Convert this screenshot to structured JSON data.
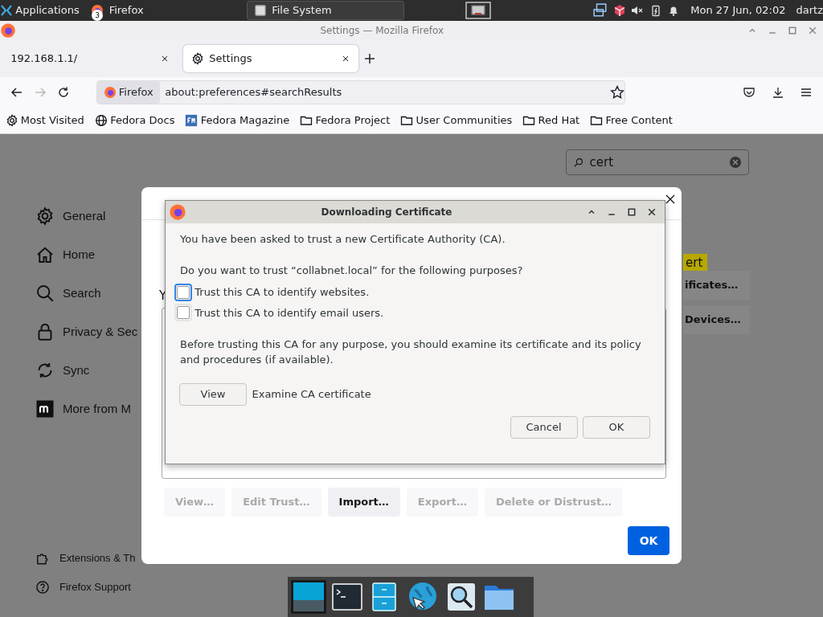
{
  "top_panel": {
    "applications": "Applications",
    "tasks": [
      {
        "label": "Firefox",
        "badge": "3",
        "selected": false
      },
      {
        "label": "File System",
        "selected": true
      }
    ],
    "clock": "Mon 27 Jun, 02:02",
    "user": "dartz"
  },
  "window": {
    "title": "Settings — Mozilla Firefox"
  },
  "tabs": [
    {
      "label": "192.168.1.1/",
      "selected": false
    },
    {
      "label": "Settings",
      "selected": true
    }
  ],
  "url_bar": {
    "identity": "Firefox",
    "url": "about:preferences#searchResults"
  },
  "bookmarks": [
    {
      "label": "Most Visited",
      "kind": "gear"
    },
    {
      "label": "Fedora Docs",
      "kind": "globe"
    },
    {
      "label": "Fedora Magazine",
      "kind": "magazine"
    },
    {
      "label": "Fedora Project",
      "kind": "folder"
    },
    {
      "label": "User Communities",
      "kind": "folder"
    },
    {
      "label": "Red Hat",
      "kind": "folder"
    },
    {
      "label": "Free Content",
      "kind": "folder"
    }
  ],
  "sidebar": {
    "items": [
      {
        "label": "General",
        "kind": "gear"
      },
      {
        "label": "Home",
        "kind": "home"
      },
      {
        "label": "Search",
        "kind": "search"
      },
      {
        "label": "Privacy & Sec",
        "kind": "lock"
      },
      {
        "label": "Sync",
        "kind": "sync"
      },
      {
        "label": "More from M",
        "kind": "mozilla"
      }
    ],
    "footer": [
      {
        "label": "Extensions & Th",
        "kind": "puzzle"
      },
      {
        "label": "Firefox Support",
        "kind": "help"
      }
    ]
  },
  "search": {
    "value": "cert"
  },
  "partial_results": {
    "highlight": "ert",
    "buttons": [
      "ificates…",
      "Devices…"
    ]
  },
  "certificate_manager": {
    "text_fragment": "Y",
    "buttons": [
      {
        "label": "View…",
        "disabled": true
      },
      {
        "label": "Edit Trust…",
        "disabled": true
      },
      {
        "label": "Import…",
        "disabled": false
      },
      {
        "label": "Export…",
        "disabled": true
      },
      {
        "label": "Delete or Distrust…",
        "disabled": true
      }
    ],
    "ok": "OK"
  },
  "download_dialog": {
    "title": "Downloading Certificate",
    "intro": "You have been asked to trust a new Certificate Authority (CA).",
    "question": "Do you want to trust “collabnet.local” for the following purposes?",
    "options": [
      {
        "label": "Trust this CA to identify websites.",
        "checked": false,
        "focused": true
      },
      {
        "label": "Trust this CA to identify email users.",
        "checked": false,
        "focused": false
      }
    ],
    "notice": "Before trusting this CA for any purpose, you should examine its certificate and its policy and procedures (if available).",
    "view_button": "View",
    "view_label": "Examine CA certificate",
    "buttons": [
      "Cancel",
      "OK"
    ]
  }
}
